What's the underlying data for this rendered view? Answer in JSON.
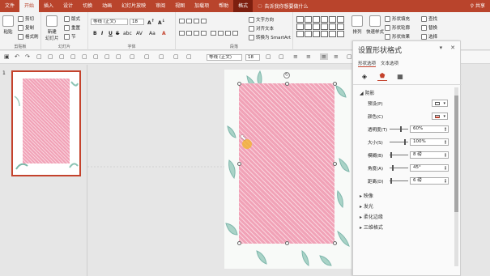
{
  "tabs": [
    "文件",
    "开始",
    "插入",
    "设计",
    "切换",
    "动画",
    "幻灯片放映",
    "审阅",
    "视图",
    "加载项",
    "帮助",
    "格式"
  ],
  "active_tab": "开始",
  "format_tab": "格式",
  "tell_me": "告诉我你想要做什么",
  "share": "共享",
  "ribbon": {
    "clipboard": {
      "paste": "粘贴",
      "cut": "剪切",
      "copy": "复制",
      "painter": "格式刷",
      "label": "剪贴板"
    },
    "slides": {
      "new": "新建",
      "new2": "幻灯片",
      "layout": "版式",
      "reset": "重置",
      "section": "节",
      "label": "幻灯片"
    },
    "font": {
      "name": "等线 (正文)",
      "size": "18",
      "label": "字体",
      "bold": "B",
      "italic": "I",
      "underline": "U",
      "strike": "S",
      "shadow": "abc",
      "spacing": "AV",
      "case": "Aa",
      "color": "A"
    },
    "paragraph": {
      "label": "段落",
      "text_dir": "文字方向",
      "align_text": "对齐文本",
      "smartart": "转换为 SmartArt"
    },
    "drawing": {
      "arrange": "排列",
      "quick_styles": "快速样式",
      "shape_fill": "形状填充",
      "shape_outline": "形状轮廓",
      "shape_effects": "形状效果",
      "find": "查找",
      "replace": "替换",
      "select": "选择"
    }
  },
  "qat": {
    "font": "等线 (正文)",
    "size": "18"
  },
  "thumbnail": {
    "number": "1"
  },
  "pane": {
    "title": "设置形状格式",
    "tabs": [
      "形状选项",
      "文本选项"
    ],
    "section_shadow": "阴影",
    "rows": [
      {
        "label": "预设(P)",
        "kind": "color"
      },
      {
        "label": "颜色(C)",
        "kind": "color"
      },
      {
        "label": "透明度(T)",
        "value": "60%"
      },
      {
        "label": "大小(S)",
        "value": "100%"
      },
      {
        "label": "模糊(B)",
        "value": "8 磅"
      },
      {
        "label": "角度(A)",
        "value": "45°"
      },
      {
        "label": "距离(D)",
        "value": "6 磅"
      }
    ],
    "sections": [
      "映像",
      "发光",
      "柔化边缘",
      "三维格式"
    ]
  },
  "colors": {
    "accent": "#b9442c",
    "pink": "#f1a2b7"
  }
}
